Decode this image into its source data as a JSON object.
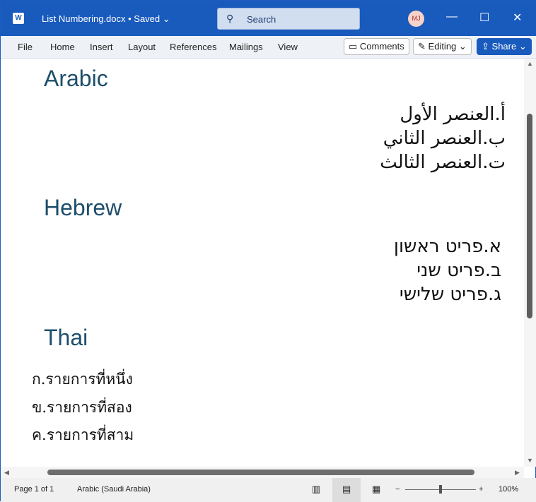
{
  "titlebar": {
    "doc_title": "List Numbering.docx • Saved ⌄",
    "search_placeholder": "Search",
    "avatar": "MJ"
  },
  "ribbon": {
    "tabs": [
      "File",
      "Home",
      "Insert",
      "Layout",
      "References",
      "Mailings",
      "View"
    ],
    "comments": "Comments",
    "editing": "Editing ⌄",
    "share": "Share ⌄"
  },
  "document": {
    "arabic": {
      "heading": "Arabic",
      "items": [
        "أ.العنصر الأول",
        "ب.العنصر الثاني",
        "ت.العنصر الثالث"
      ]
    },
    "hebrew": {
      "heading": "Hebrew",
      "items": [
        "א.פריט ראשון",
        "ב.פריט שני",
        "ג.פריט שלישי"
      ]
    },
    "thai": {
      "heading": "Thai",
      "items": [
        "ก.รายการที่หนึ่ง",
        "ข.รายการที่สอง",
        "ค.รายการที่สาม"
      ]
    }
  },
  "status": {
    "page": "Page 1 of 1",
    "language": "Arabic (Saudi Arabia)",
    "zoom": "100%",
    "zoom_percent": 100
  }
}
